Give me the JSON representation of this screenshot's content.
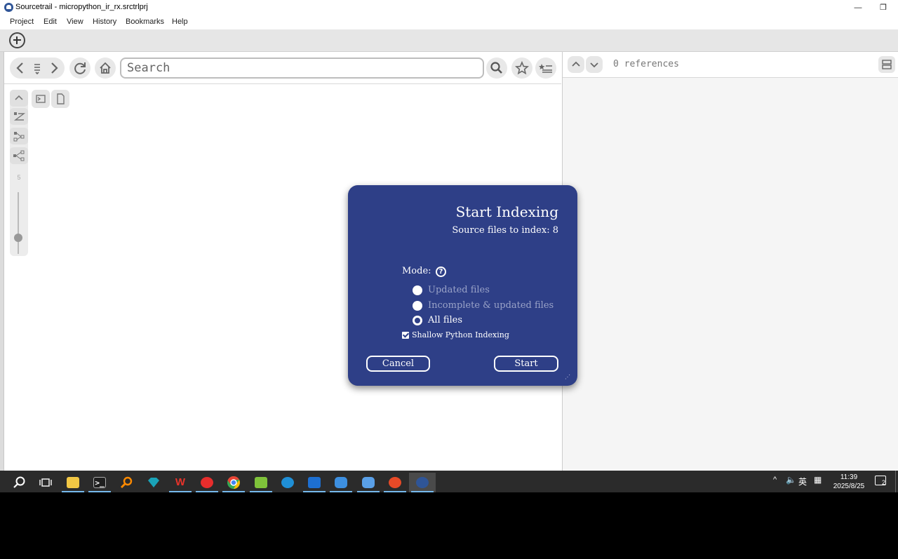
{
  "window": {
    "title": "Sourcetrail - micropython_ir_rx.srctrlprj",
    "minimize": "—",
    "restore": "❐"
  },
  "menu": [
    {
      "label": "Project"
    },
    {
      "label": "Edit"
    },
    {
      "label": "View"
    },
    {
      "label": "History"
    },
    {
      "label": "Bookmarks"
    },
    {
      "label": "Help"
    }
  ],
  "search": {
    "placeholder": "Search"
  },
  "toolbar_icons": {
    "back": "chevron-left-icon",
    "history": "history-list-icon",
    "forward": "chevron-right-icon",
    "refresh": "refresh-icon",
    "home": "home-icon",
    "search": "search-icon",
    "bookmark": "star-icon",
    "bookmarks_list": "bookmark-list-icon"
  },
  "references": {
    "count_text": "0 references"
  },
  "graph": {
    "zoom_label": "5"
  },
  "dialog": {
    "title": "Start Indexing",
    "subtitle": "Source files to index: 8",
    "mode_label": "Mode:",
    "help_glyph": "?",
    "options": [
      {
        "label": "Updated files",
        "selected": false,
        "enabled": false
      },
      {
        "label": "Incomplete & updated files",
        "selected": false,
        "enabled": false
      },
      {
        "label": "All files",
        "selected": true,
        "enabled": true
      }
    ],
    "shallow_label": "Shallow Python Indexing",
    "shallow_checked": true,
    "cancel_label": "Cancel",
    "start_label": "Start",
    "bg_color": "#2e3f87"
  },
  "taskbar": {
    "lang": "英",
    "time": "11:39",
    "date": "2025/8/25",
    "notifications": "2"
  }
}
